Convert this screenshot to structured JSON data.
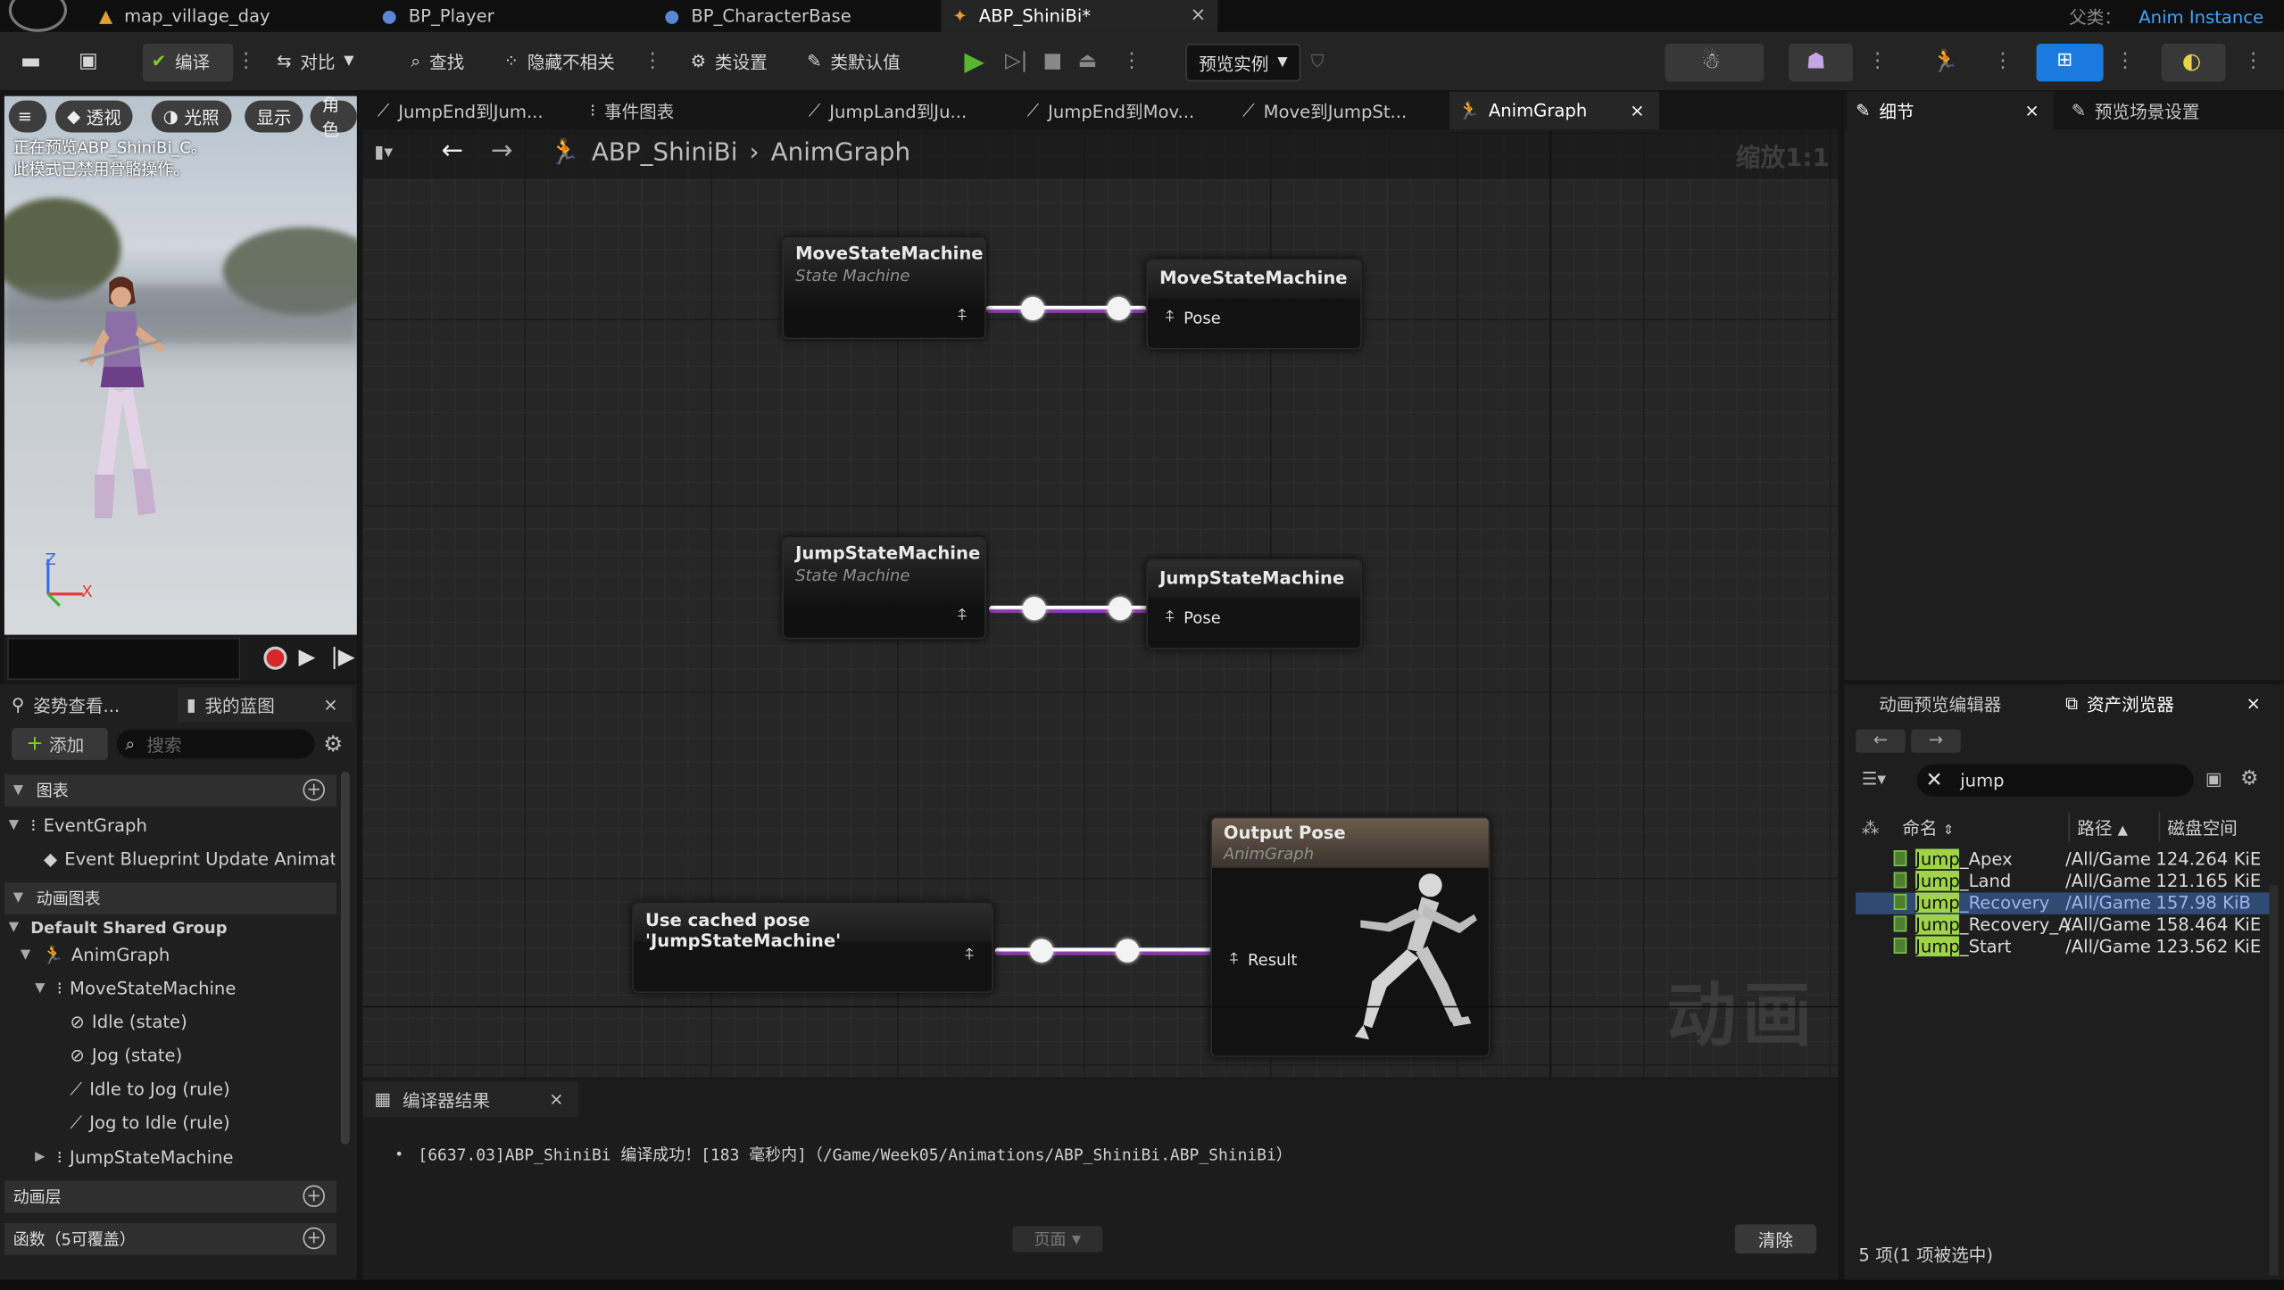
{
  "doc_tabs": [
    {
      "label": "map_village_day",
      "icon": "level-icon"
    },
    {
      "label": "BP_Player",
      "icon": "blueprint-person-icon"
    },
    {
      "label": "BP_CharacterBase",
      "icon": "blueprint-person-icon"
    },
    {
      "label": "ABP_ShiniBi*",
      "icon": "anim-blueprint-icon"
    }
  ],
  "parent_class": {
    "label": "父类：",
    "value": "Anim Instance"
  },
  "toolbar": {
    "compile": "编译",
    "diff": "对比",
    "find": "查找",
    "hide_unrelated": "隐藏不相关",
    "class_settings": "类设置",
    "class_defaults": "类默认值",
    "preview_instance": "预览实例"
  },
  "viewport": {
    "buttons": [
      "透视",
      "光照",
      "显示",
      "角色"
    ],
    "message_line1": "正在预览ABP_ShiniBi_C。",
    "message_line2": "此模式已禁用骨骼操作。",
    "axis_z": "Z",
    "axis_x": "X"
  },
  "left_panel": {
    "tab_pose": "姿势查看...",
    "tab_blueprint": "我的蓝图",
    "add": "添加",
    "search_placeholder": "搜索",
    "sec_graphs": "图表",
    "event_graph": "EventGraph",
    "event_update": "Event Blueprint Update Animation",
    "sec_anim_graphs": "动画图表",
    "default_group": "Default Shared Group",
    "anim_graph": "AnimGraph",
    "move_sm": "MoveStateMachine",
    "idle": "Idle (state)",
    "jog": "Jog (state)",
    "idle_to_jog": "Idle to Jog (rule)",
    "jog_to_idle": "Jog to Idle (rule)",
    "jump_sm": "JumpStateMachine",
    "sec_layers": "动画层",
    "sec_functions": "函数（5可覆盖）"
  },
  "graph_tabs": [
    "JumpEnd到Jum...",
    "事件图表",
    "JumpLand到Ju...",
    "JumpEnd到Mov...",
    "Move到JumpSt...",
    "AnimGraph"
  ],
  "breadcrumb": {
    "root": "ABP_ShiniBi",
    "current": "AnimGraph",
    "zoom": "缩放1:1"
  },
  "nodes": {
    "move_sm": {
      "title": "MoveStateMachine",
      "sub": "State Machine"
    },
    "move_cache": {
      "title": "MoveStateMachine",
      "pin": "Pose"
    },
    "jump_sm": {
      "title": "JumpStateMachine",
      "sub": "State Machine"
    },
    "jump_cache": {
      "title": "JumpStateMachine",
      "pin": "Pose"
    },
    "use_cached": {
      "title": "Use cached pose 'JumpStateMachine'"
    },
    "output": {
      "title": "Output Pose",
      "sub": "AnimGraph",
      "pin": "Result"
    }
  },
  "graph_watermark": "动画",
  "compiler": {
    "tab": "编译器结果",
    "log": "[6637.03]ABP_ShiniBi 编译成功！[183 毫秒内]（/Game/Week05/Animations/ABP_ShiniBi.ABP_ShiniBi）",
    "page": "页面",
    "clear": "清除"
  },
  "right_panel": {
    "tab_details": "细节",
    "tab_preview_scene": "预览场景设置",
    "tab_anim_preview": "动画预览编辑器",
    "tab_asset_browser": "资产浏览器",
    "search_value": "jump",
    "col_name": "命名",
    "col_path": "路径",
    "col_disk": "磁盘空间",
    "status": "5 项(1 项被选中)"
  },
  "assets": [
    {
      "prefix": "Jump",
      "rest": "_Apex",
      "path": "/All/Game",
      "size": "124.264 KiE",
      "selected": false
    },
    {
      "prefix": "Jump",
      "rest": "_Land",
      "path": "/All/Game",
      "size": "121.165 KiE",
      "selected": false
    },
    {
      "prefix": "Jump",
      "rest": "_Recovery",
      "path": "/All/Game",
      "size": "157.98 KiB",
      "selected": true
    },
    {
      "prefix": "Jump",
      "rest": "_Recovery_A",
      "path": "/All/Game",
      "size": "158.464 KiE",
      "selected": false
    },
    {
      "prefix": "Jump",
      "rest": "_Start",
      "path": "/All/Game",
      "size": "123.562 KiE",
      "selected": false
    }
  ],
  "colors": {
    "accent_blue": "#3fa4ff",
    "pose_wire": "#8a3aa8",
    "highlight": "#9fd44a",
    "selected_row": "#2f4a73"
  }
}
